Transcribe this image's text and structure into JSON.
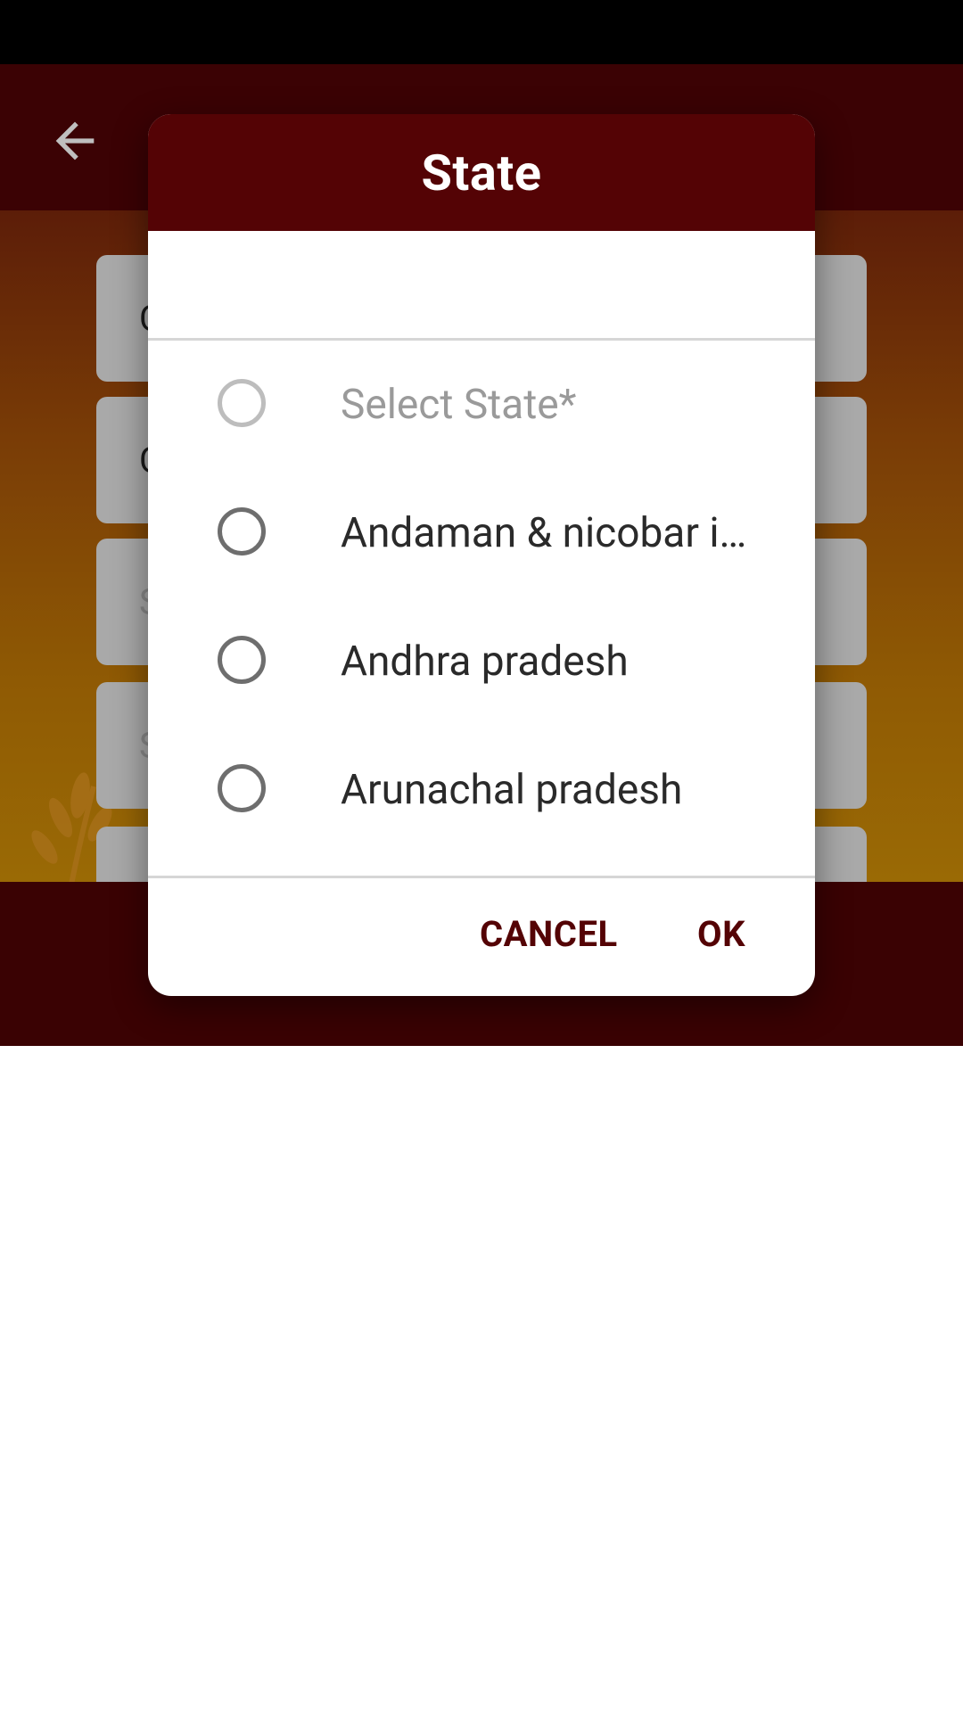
{
  "dialog": {
    "title": "State",
    "options": [
      {
        "label": "Select State*",
        "placeholder": true
      },
      {
        "label": "Andaman & nicobar islands",
        "placeholder": false
      },
      {
        "label": "Andhra pradesh",
        "placeholder": false
      },
      {
        "label": "Arunachal pradesh",
        "placeholder": false
      }
    ],
    "cancel_label": "CANCEL",
    "ok_label": "OK"
  },
  "background_form": {
    "field_peeks": [
      "C",
      "C",
      "S",
      "S",
      ""
    ]
  },
  "colors": {
    "toolbar": "#3b0204",
    "dialog_header": "#540305",
    "action_text": "#540305"
  },
  "icons": {
    "back": "arrow-left-icon",
    "radio": "radio-unchecked-icon"
  }
}
